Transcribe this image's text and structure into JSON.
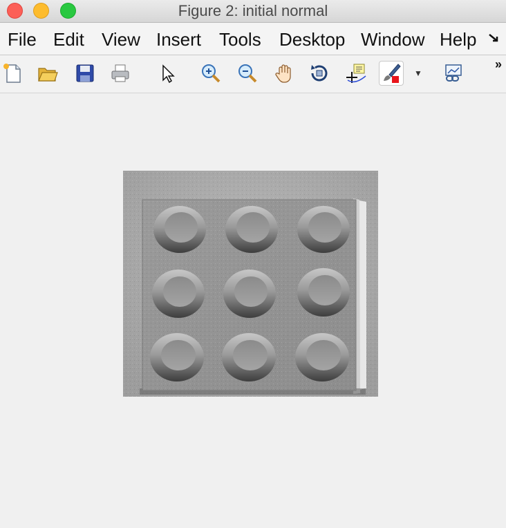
{
  "window": {
    "title": "Figure 2: initial normal",
    "controls": [
      "close",
      "minimize",
      "zoom"
    ]
  },
  "menubar": {
    "items": [
      {
        "label": "File"
      },
      {
        "label": "Edit"
      },
      {
        "label": "View"
      },
      {
        "label": "Insert"
      },
      {
        "label": "Tools"
      },
      {
        "label": "Desktop"
      },
      {
        "label": "Window"
      },
      {
        "label": "Help"
      }
    ],
    "more_icon": "menu-overflow-arrow-icon"
  },
  "toolbar": {
    "tools": [
      {
        "name": "new-figure",
        "icon": "new-document-icon"
      },
      {
        "name": "open-file",
        "icon": "open-folder-icon"
      },
      {
        "name": "save-figure",
        "icon": "floppy-disk-icon"
      },
      {
        "name": "print-figure",
        "icon": "printer-icon"
      },
      {
        "name": "edit-plot",
        "icon": "arrow-pointer-icon"
      },
      {
        "name": "zoom-in",
        "icon": "zoom-in-icon"
      },
      {
        "name": "zoom-out",
        "icon": "zoom-out-icon"
      },
      {
        "name": "pan",
        "icon": "hand-icon"
      },
      {
        "name": "rotate-3d",
        "icon": "rotate-3d-icon"
      },
      {
        "name": "data-cursor",
        "icon": "data-cursor-icon"
      },
      {
        "name": "brush",
        "icon": "brush-icon"
      },
      {
        "name": "link-plot",
        "icon": "link-plot-icon"
      }
    ],
    "overflow_label": "»"
  },
  "figure": {
    "content": "grayscale image of a flat plate with nine circular dimples in a 3x3 grid"
  }
}
